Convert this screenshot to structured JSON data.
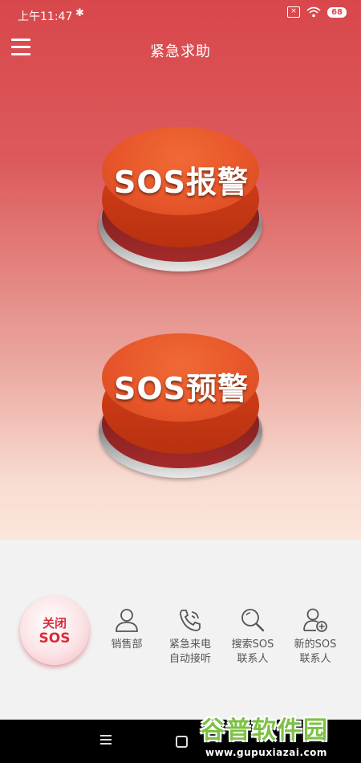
{
  "status_bar": {
    "time": "上午11:47",
    "battery": "68",
    "bluetooth_icon": "bluetooth-icon",
    "wifi_icon": "wifi-icon"
  },
  "header": {
    "title": "紧急求助",
    "menu_icon": "hamburger-menu-icon"
  },
  "buttons": {
    "sos_alarm": "SOS报警",
    "sos_warning": "SOS预警"
  },
  "close_sos": {
    "line1": "关闭",
    "line2": "SOS"
  },
  "actions": [
    {
      "label": "销售部",
      "icon": "person-icon"
    },
    {
      "label1": "紧急来电",
      "label2": "自动接听",
      "icon": "phone-call-icon"
    },
    {
      "label1": "搜索SOS",
      "label2": "联系人",
      "icon": "search-icon"
    },
    {
      "label1": "新的SOS",
      "label2": "联系人",
      "icon": "add-person-icon"
    }
  ],
  "watermark": {
    "brand": "谷普软件园",
    "url": "www.gupuxiazai.com"
  },
  "colors": {
    "primary": "#d8474b",
    "accent": "#e7552a",
    "close_text": "#d62d3a",
    "watermark": "#7cc242"
  }
}
